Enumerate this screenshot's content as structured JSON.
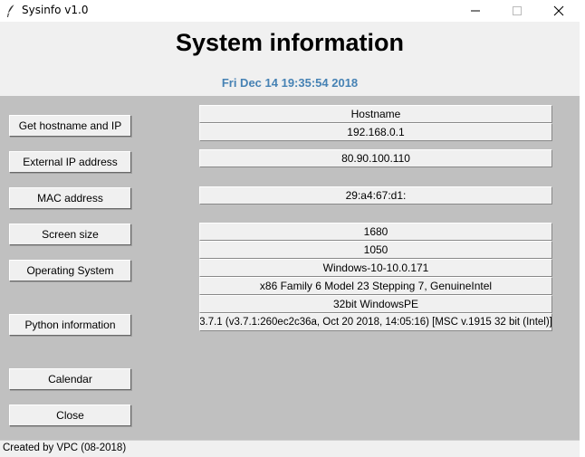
{
  "window": {
    "title": "Sysinfo v1.0",
    "icon": "feather-icon",
    "controls": [
      "minimize-icon",
      "maximize-icon",
      "close-icon"
    ]
  },
  "header": {
    "title": "System information",
    "datetime": "Fri Dec 14 19:35:54 2018",
    "datetime_color": "#4682b4"
  },
  "buttons": {
    "hostname_ip": "Get hostname and IP",
    "external_ip": "External IP address",
    "mac": "MAC address",
    "screen": "Screen size",
    "os": "Operating System",
    "python": "Python information",
    "calendar": "Calendar",
    "close": "Close"
  },
  "fields": {
    "hostname_label": "Hostname",
    "local_ip": "192.168.0.1",
    "external_ip": "80.90.100.110",
    "mac": "29:a4:67:d1:",
    "screen_width": "1680",
    "screen_height": "1050",
    "os_version": "Windows-10-10.0.171",
    "processor": "x86 Family 6 Model 23 Stepping 7, GenuineIntel",
    "architecture": "32bit WindowsPE",
    "python_version": "3.7.1 (v3.7.1:260ec2c36a, Oct 20 2018, 14:05:16) [MSC v.1915 32 bit (Intel)]"
  },
  "status": {
    "text": "Created by VPC (08-2018)"
  },
  "colors": {
    "panel": "#c0c0c0",
    "header_bg": "#f0f0f0"
  }
}
